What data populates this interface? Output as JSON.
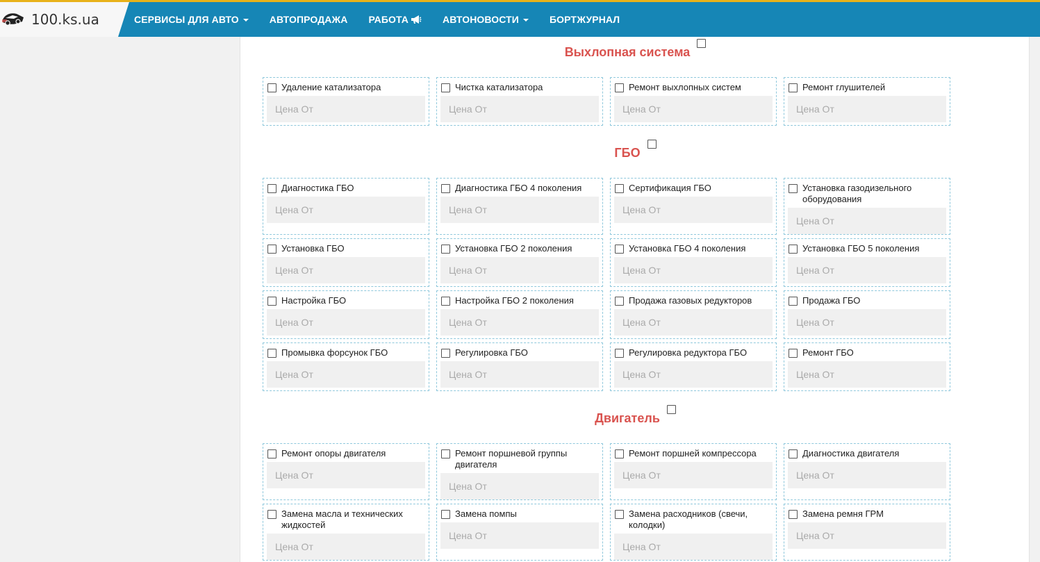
{
  "logo": {
    "text": "100.ks.ua"
  },
  "nav": [
    {
      "label": "СЕРВИСЫ ДЛЯ АВТО",
      "dropdown": true
    },
    {
      "label": "АВТОПРОДАЖА",
      "dropdown": false
    },
    {
      "label": "РАБОТА",
      "icon": "megaphone-icon"
    },
    {
      "label": "АВТОНОВОСТИ",
      "dropdown": true
    },
    {
      "label": "БОРТЖУРНАЛ",
      "dropdown": false
    }
  ],
  "price_placeholder": "Цена От",
  "sections": [
    {
      "title": "Выхлопная система",
      "items": [
        "Удаление катализатора",
        "Чистка катализатора",
        "Ремонт выхлопных систем",
        "Ремонт глушителей"
      ]
    },
    {
      "title": "ГБО",
      "items": [
        "Диагностика ГБО",
        "Диагностика ГБО 4 поколения",
        "Сертификация ГБО",
        "Установка газодизельного оборудования",
        "Установка ГБО",
        "Установка ГБО 2 поколения",
        "Установка ГБО 4 поколения",
        "Установка ГБО 5 поколения",
        "Настройка ГБО",
        "Настройка ГБО 2 поколения",
        "Продажа газовых редукторов",
        "Продажа ГБО",
        "Промывка форсунок ГБО",
        "Регулировка ГБО",
        "Регулировка редуктора ГБО",
        "Ремонт ГБО"
      ]
    },
    {
      "title": "Двигатель",
      "items": [
        "Ремонт опоры двигателя",
        "Ремонт поршневой группы двигателя",
        "Ремонт поршней компрессора",
        "Диагностика двигателя",
        "Замена масла и технических жидкостей",
        "Замена помпы",
        "Замена расходников (свечи, колодки)",
        "Замена ремня ГРМ"
      ]
    }
  ],
  "colors": {
    "nav_bg": "#1686b6",
    "accent_top": "#e8b21a",
    "section_title": "#d9534f",
    "card_border": "#8fc8dc"
  }
}
